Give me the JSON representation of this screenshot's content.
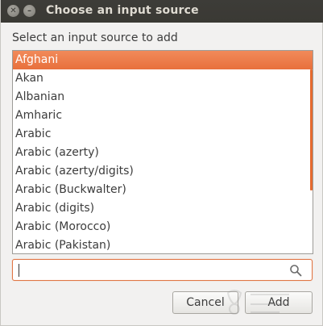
{
  "window": {
    "title": "Choose an input source",
    "close_glyph": "✕",
    "minimize_glyph": "–"
  },
  "prompt": "Select an input source to add",
  "list": {
    "items": [
      {
        "label": "Afghani",
        "selected": true
      },
      {
        "label": "Akan",
        "selected": false
      },
      {
        "label": "Albanian",
        "selected": false
      },
      {
        "label": "Amharic",
        "selected": false
      },
      {
        "label": "Arabic",
        "selected": false
      },
      {
        "label": "Arabic (azerty)",
        "selected": false
      },
      {
        "label": "Arabic (azerty/digits)",
        "selected": false
      },
      {
        "label": "Arabic (Buckwalter)",
        "selected": false
      },
      {
        "label": "Arabic (digits)",
        "selected": false
      },
      {
        "label": "Arabic (Morocco)",
        "selected": false
      },
      {
        "label": "Arabic (Pakistan)",
        "selected": false
      }
    ]
  },
  "search": {
    "value": "",
    "placeholder": "",
    "icon": "search-icon"
  },
  "buttons": {
    "cancel_label": "Cancel",
    "add_label": "Add"
  },
  "colors": {
    "accent": "#e8703c",
    "titlebar": "#3c3b37"
  }
}
